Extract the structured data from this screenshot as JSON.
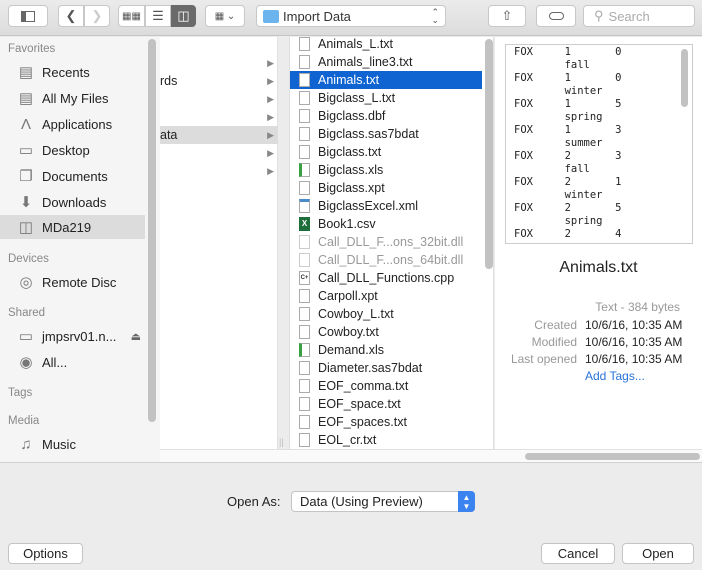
{
  "toolbar": {
    "location": "Import Data",
    "search_placeholder": "Search"
  },
  "sidebar": {
    "favorites_header": "Favorites",
    "favorites": [
      {
        "label": "Recents",
        "icon": "recents-icon"
      },
      {
        "label": "All My Files",
        "icon": "all-files-icon"
      },
      {
        "label": "Applications",
        "icon": "applications-icon"
      },
      {
        "label": "Desktop",
        "icon": "desktop-icon"
      },
      {
        "label": "Documents",
        "icon": "documents-icon"
      },
      {
        "label": "Downloads",
        "icon": "downloads-icon"
      },
      {
        "label": "MDa219",
        "icon": "disk-icon"
      }
    ],
    "devices_header": "Devices",
    "devices": [
      {
        "label": "Remote Disc"
      }
    ],
    "shared_header": "Shared",
    "shared": [
      {
        "label": "jmpsrv01.n..."
      },
      {
        "label": "All..."
      }
    ],
    "tags_header": "Tags",
    "media_header": "Media",
    "media": [
      {
        "label": "Music"
      }
    ]
  },
  "column1": [
    "",
    "rds",
    "",
    "",
    "ata",
    "",
    ""
  ],
  "files": [
    {
      "name": "Animals_L.txt",
      "type": "txt"
    },
    {
      "name": "Animals_line3.txt",
      "type": "txt"
    },
    {
      "name": "Animals.txt",
      "type": "txt",
      "selected": true
    },
    {
      "name": "Bigclass_L.txt",
      "type": "txt"
    },
    {
      "name": "Bigclass.dbf",
      "type": "txt"
    },
    {
      "name": "Bigclass.sas7bdat",
      "type": "txt"
    },
    {
      "name": "Bigclass.txt",
      "type": "txt"
    },
    {
      "name": "Bigclass.xls",
      "type": "xls"
    },
    {
      "name": "Bigclass.xpt",
      "type": "txt"
    },
    {
      "name": "BigclassExcel.xml",
      "type": "xml"
    },
    {
      "name": "Book1.csv",
      "type": "csv"
    },
    {
      "name": "Call_DLL_F...ons_32bit.dll",
      "type": "dll",
      "disabled": true
    },
    {
      "name": "Call_DLL_F...ons_64bit.dll",
      "type": "dll",
      "disabled": true
    },
    {
      "name": "Call_DLL_Functions.cpp",
      "type": "cpp"
    },
    {
      "name": "Carpoll.xpt",
      "type": "txt"
    },
    {
      "name": "Cowboy_L.txt",
      "type": "txt"
    },
    {
      "name": "Cowboy.txt",
      "type": "txt"
    },
    {
      "name": "Demand.xls",
      "type": "xls"
    },
    {
      "name": "Diameter.sas7bdat",
      "type": "txt"
    },
    {
      "name": "EOF_comma.txt",
      "type": "txt"
    },
    {
      "name": "EOF_space.txt",
      "type": "txt"
    },
    {
      "name": "EOF_spaces.txt",
      "type": "txt"
    },
    {
      "name": "EOL_cr.txt",
      "type": "txt"
    }
  ],
  "preview": {
    "lines": [
      "FOX     1       0",
      "        fall",
      "FOX     1       0",
      "        winter",
      "FOX     1       5",
      "        spring",
      "FOX     1       3",
      "        summer",
      "FOX     2       3",
      "        fall",
      "FOX     2       1",
      "        winter",
      "FOX     2       5",
      "        spring",
      "FOX     2       4"
    ],
    "filename": "Animals.txt",
    "kind": "Text - 384 bytes",
    "created_label": "Created",
    "created": "10/6/16, 10:35 AM",
    "modified_label": "Modified",
    "modified": "10/6/16, 10:35 AM",
    "opened_label": "Last opened",
    "opened": "10/6/16, 10:35 AM",
    "add_tags": "Add Tags..."
  },
  "bottom": {
    "open_as_label": "Open As:",
    "open_as_value": "Data (Using Preview)",
    "options": "Options",
    "cancel": "Cancel",
    "open": "Open"
  }
}
